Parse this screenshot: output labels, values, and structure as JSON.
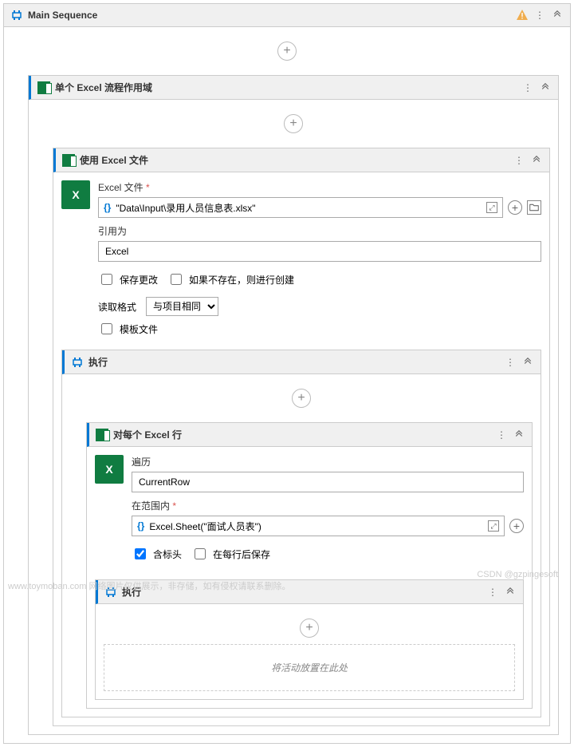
{
  "main": {
    "title": "Main Sequence"
  },
  "scope": {
    "title": "单个 Excel 流程作用域"
  },
  "useExcel": {
    "title": "使用 Excel 文件",
    "fileLabel": "Excel 文件",
    "fileValue": "\"Data\\Input\\录用人员信息表.xlsx\"",
    "refLabel": "引用为",
    "refValue": "Excel",
    "saveChanges": "保存更改",
    "createIfNotExist": "如果不存在，则进行创建",
    "readFormatLabel": "读取格式",
    "readFormatValue": "与项目相同",
    "templateFile": "模板文件"
  },
  "execute1": {
    "title": "执行"
  },
  "forEach": {
    "title": "对每个 Excel 行",
    "loopLabel": "遍历",
    "loopValue": "CurrentRow",
    "rangeLabel": "在范围内",
    "rangeValue": "Excel.Sheet(\"面试人员表\")",
    "hasHeader": "含标头",
    "saveAfterRow": "在每行后保存"
  },
  "execute2": {
    "title": "执行"
  },
  "dropHint": "将活动放置在此处",
  "watermark1": "www.toymoban.com 网络图片仅供展示，非存储，如有侵权请联系删除。",
  "watermark2": "CSDN @gzpingesoft"
}
